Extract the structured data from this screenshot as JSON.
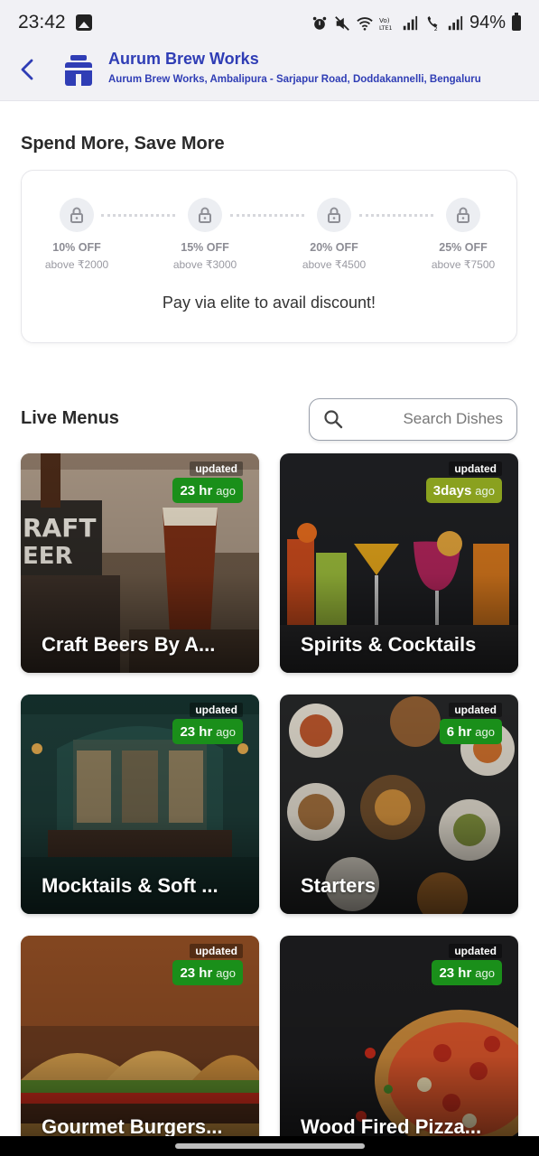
{
  "status_bar": {
    "time": "23:42",
    "battery": "94%",
    "icons": [
      "image-icon",
      "alarm-icon",
      "mute-icon",
      "wifi-icon",
      "volte-icon",
      "signal-icon",
      "wifi-calling-icon",
      "signal-icon",
      "battery-icon"
    ]
  },
  "header": {
    "title": "Aurum Brew Works",
    "subtitle": "Aurum Brew Works, Ambalipura - Sarjapur Road, Doddakannelli, Bengaluru",
    "accent": "#2f3db5"
  },
  "offers": {
    "title": "Spend More, Save More",
    "tiers": [
      {
        "off": "10% OFF",
        "above": "above ₹2000"
      },
      {
        "off": "15% OFF",
        "above": "above ₹3000"
      },
      {
        "off": "20% OFF",
        "above": "above ₹4500"
      },
      {
        "off": "25% OFF",
        "above": "above ₹7500"
      }
    ],
    "note": "Pay via elite to avail discount!"
  },
  "live_menus": {
    "title": "Live Menus",
    "search_placeholder": "Search Dishes",
    "updated_label": "updated",
    "cards": [
      {
        "name": "Craft Beers By A...",
        "value": "23 hr",
        "unit": "ago",
        "badge_color": "#1a8f1a"
      },
      {
        "name": "Spirits & Cocktails",
        "value": "3days",
        "unit": "ago",
        "badge_color": "#8aa11f"
      },
      {
        "name": "Mocktails & Soft ...",
        "value": "23 hr",
        "unit": "ago",
        "badge_color": "#1a8f1a"
      },
      {
        "name": "Starters",
        "value": "6 hr",
        "unit": "ago",
        "badge_color": "#1a8f1a"
      },
      {
        "name": "Gourmet Burgers...",
        "value": "23 hr",
        "unit": "ago",
        "badge_color": "#1a8f1a"
      },
      {
        "name": "Wood Fired Pizza...",
        "value": "23 hr",
        "unit": "ago",
        "badge_color": "#1a8f1a"
      }
    ]
  }
}
